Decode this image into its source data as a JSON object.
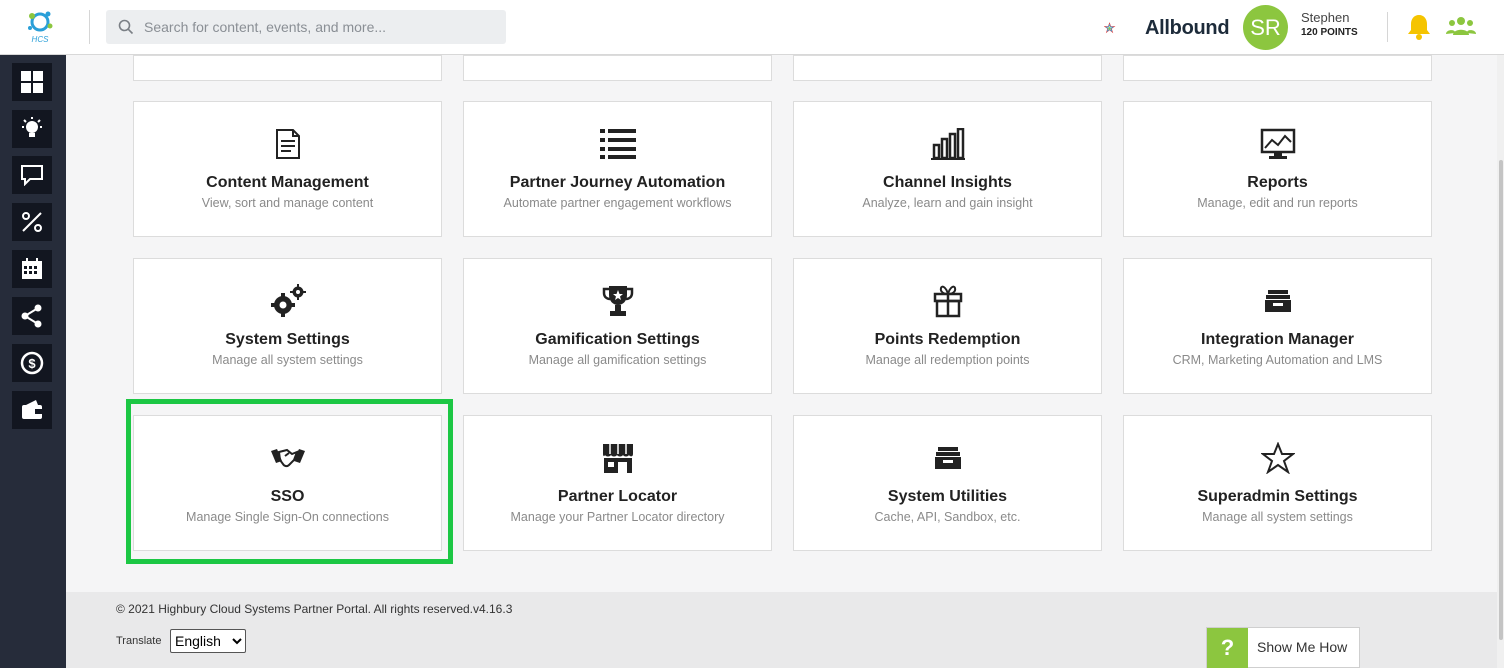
{
  "header": {
    "search_placeholder": "Search for content, events, and more...",
    "brand": "Allbound",
    "user": {
      "initials": "SR",
      "name": "Stephen",
      "points": "120 POINTS"
    }
  },
  "sidebar": {
    "items": [
      {
        "icon": "dashboard-grid-icon"
      },
      {
        "icon": "lightbulb-icon"
      },
      {
        "icon": "chat-icon"
      },
      {
        "icon": "percent-icon"
      },
      {
        "icon": "calendar-icon"
      },
      {
        "icon": "share-icon"
      },
      {
        "icon": "dollar-icon"
      },
      {
        "icon": "wallet-icon"
      }
    ]
  },
  "cards": [
    {
      "title": "Content Management",
      "desc": "View, sort and manage content",
      "icon": "document-icon"
    },
    {
      "title": "Partner Journey Automation",
      "desc": "Automate partner engagement workflows",
      "icon": "list-icon"
    },
    {
      "title": "Channel Insights",
      "desc": "Analyze, learn and gain insight",
      "icon": "bar-chart-icon"
    },
    {
      "title": "Reports",
      "desc": "Manage, edit and run reports",
      "icon": "monitor-chart-icon"
    },
    {
      "title": "System Settings",
      "desc": "Manage all system settings",
      "icon": "gears-icon"
    },
    {
      "title": "Gamification Settings",
      "desc": "Manage all gamification settings",
      "icon": "trophy-icon"
    },
    {
      "title": "Points Redemption",
      "desc": "Manage all redemption points",
      "icon": "gift-icon"
    },
    {
      "title": "Integration Manager",
      "desc": "CRM, Marketing Automation and LMS",
      "icon": "drawer-icon"
    },
    {
      "title": "SSO",
      "desc": "Manage Single Sign-On connections",
      "icon": "handshake-icon"
    },
    {
      "title": "Partner Locator",
      "desc": "Manage your Partner Locator directory",
      "icon": "storefront-icon"
    },
    {
      "title": "System Utilities",
      "desc": "Cache, API, Sandbox, etc.",
      "icon": "drawer-icon"
    },
    {
      "title": "Superadmin Settings",
      "desc": "Manage all system settings",
      "icon": "star-outline-icon"
    }
  ],
  "footer": {
    "copyright": "© 2021 Highbury Cloud Systems Partner Portal. All rights reserved.v4.16.3",
    "translate_label": "Translate",
    "language": "English",
    "language_options": [
      "English"
    ]
  },
  "help": {
    "icon_text": "?",
    "label": "Show Me How"
  },
  "colors": {
    "accent_green": "#8cc63f",
    "highlight_green": "#1cc744",
    "sidebar_bg": "#262c3a"
  }
}
